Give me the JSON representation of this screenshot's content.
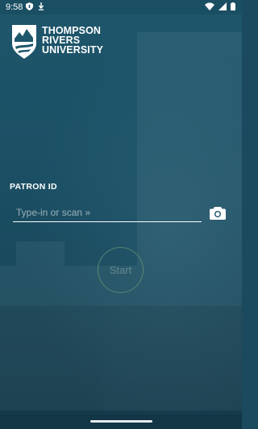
{
  "status_bar": {
    "time": "9:58",
    "icons": [
      "shield-icon",
      "download-icon",
      "wifi-icon",
      "signal-icon",
      "battery-icon"
    ]
  },
  "logo": {
    "line1": "THOMPSON",
    "line2": "RIVERS",
    "line3": "UNIVERSITY"
  },
  "form": {
    "label": "PATRON ID",
    "placeholder": "Type-in or scan »",
    "value": ""
  },
  "start_button": {
    "label": "Start"
  },
  "colors": {
    "background": "#1b4a5f",
    "text": "#ffffff",
    "start_ring": "#82aa78"
  }
}
